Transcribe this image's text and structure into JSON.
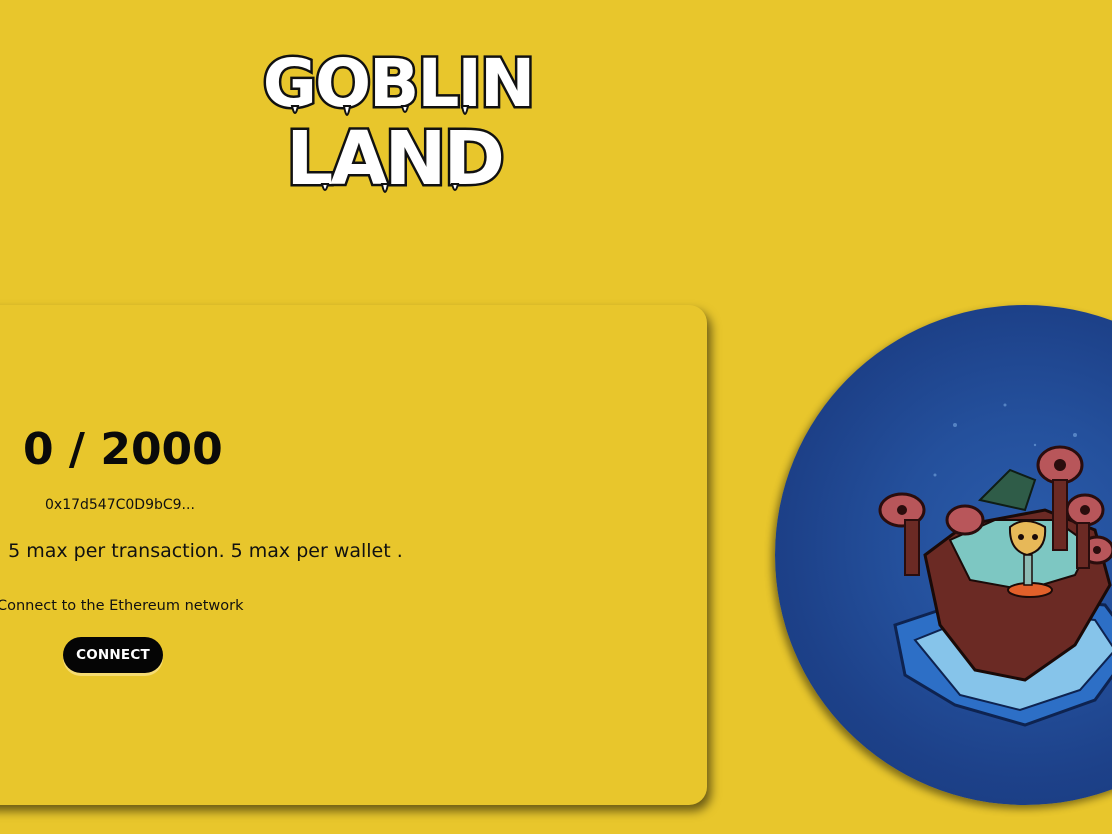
{
  "logo": {
    "line1": "GOBLIN",
    "line2": "LAND"
  },
  "mint": {
    "counter": "0 / 2000",
    "contract_address": "0x17d547C0D9bC9...",
    "limits_text": ". 5 max per transaction. 5 max per wallet .",
    "network_text": "Connect to the Ethereum network",
    "connect_label": "CONNECT"
  },
  "colors": {
    "background": "#e8c62c",
    "button": "#050505",
    "circle": "#24509c"
  }
}
